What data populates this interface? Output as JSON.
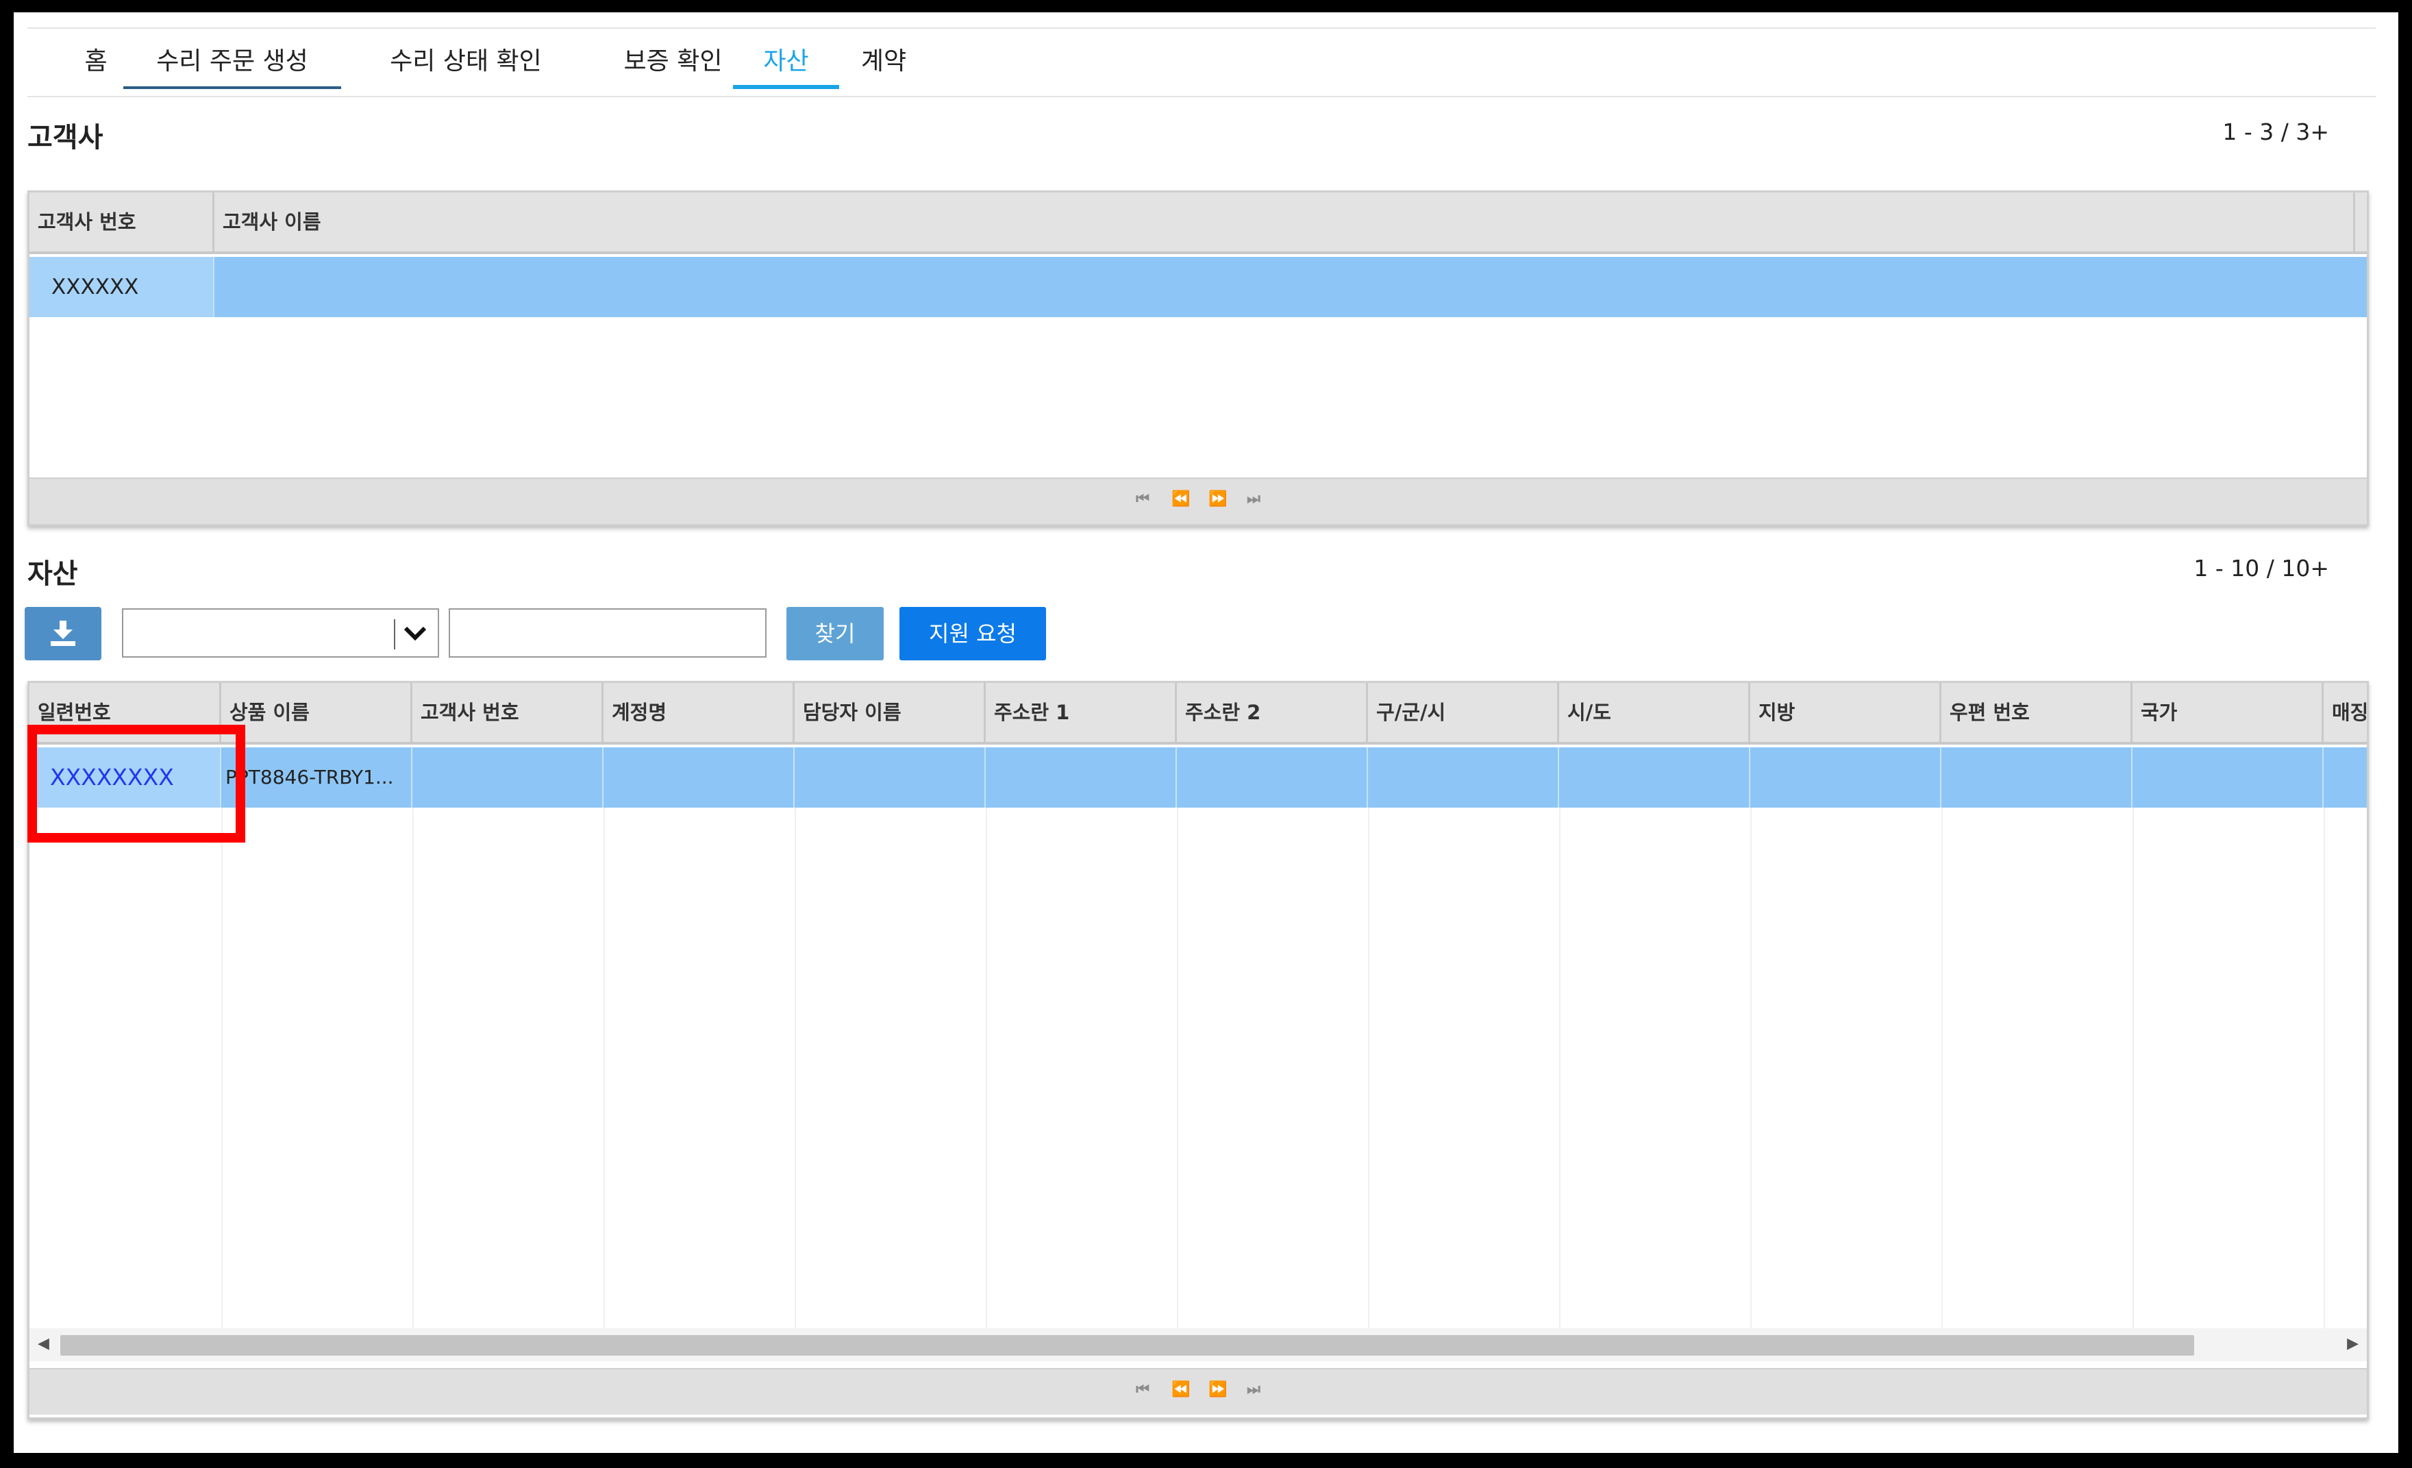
{
  "tabs": [
    {
      "label": "홈"
    },
    {
      "label": "수리 주문 생성"
    },
    {
      "label": "수리 상태 확인"
    },
    {
      "label": "보증 확인"
    },
    {
      "label": "자산"
    },
    {
      "label": "계약"
    }
  ],
  "customers": {
    "title": "고객사",
    "count": "1 - 3 / 3+",
    "columns": [
      "고객사 번호",
      "고객사 이름"
    ],
    "rows": [
      [
        "XXXXXX",
        ""
      ]
    ]
  },
  "assets": {
    "title": "자산",
    "count": "1 - 10 / 10+",
    "select_value": "",
    "search_placeholder": "",
    "find_label": "찾기",
    "support_label": "지원 요청",
    "columns": [
      "일련번호",
      "상품 이름",
      "고객사 번호",
      "계정명",
      "담당자 이름",
      "주소란 1",
      "주소란 2",
      "구/군/시",
      "시/도",
      "지방",
      "우편 번호",
      "국가",
      "매징"
    ],
    "rows": [
      [
        "XXXXXXXX",
        "PPT8846-TRBY1...",
        "",
        "",
        "",
        "",
        "",
        "",
        "",
        "",
        "",
        "",
        ""
      ]
    ]
  },
  "icons": {
    "download": "download-icon",
    "dropdown": "chevron-down-icon",
    "pager": [
      "first-page-icon",
      "prev-page-icon",
      "next-page-icon",
      "last-page-icon"
    ]
  },
  "colors": {
    "active_tab": "#1ba4e8",
    "selected_row": "#8dc6f6",
    "primary_button": "#0c7ae8",
    "highlight": "#ff0000"
  }
}
